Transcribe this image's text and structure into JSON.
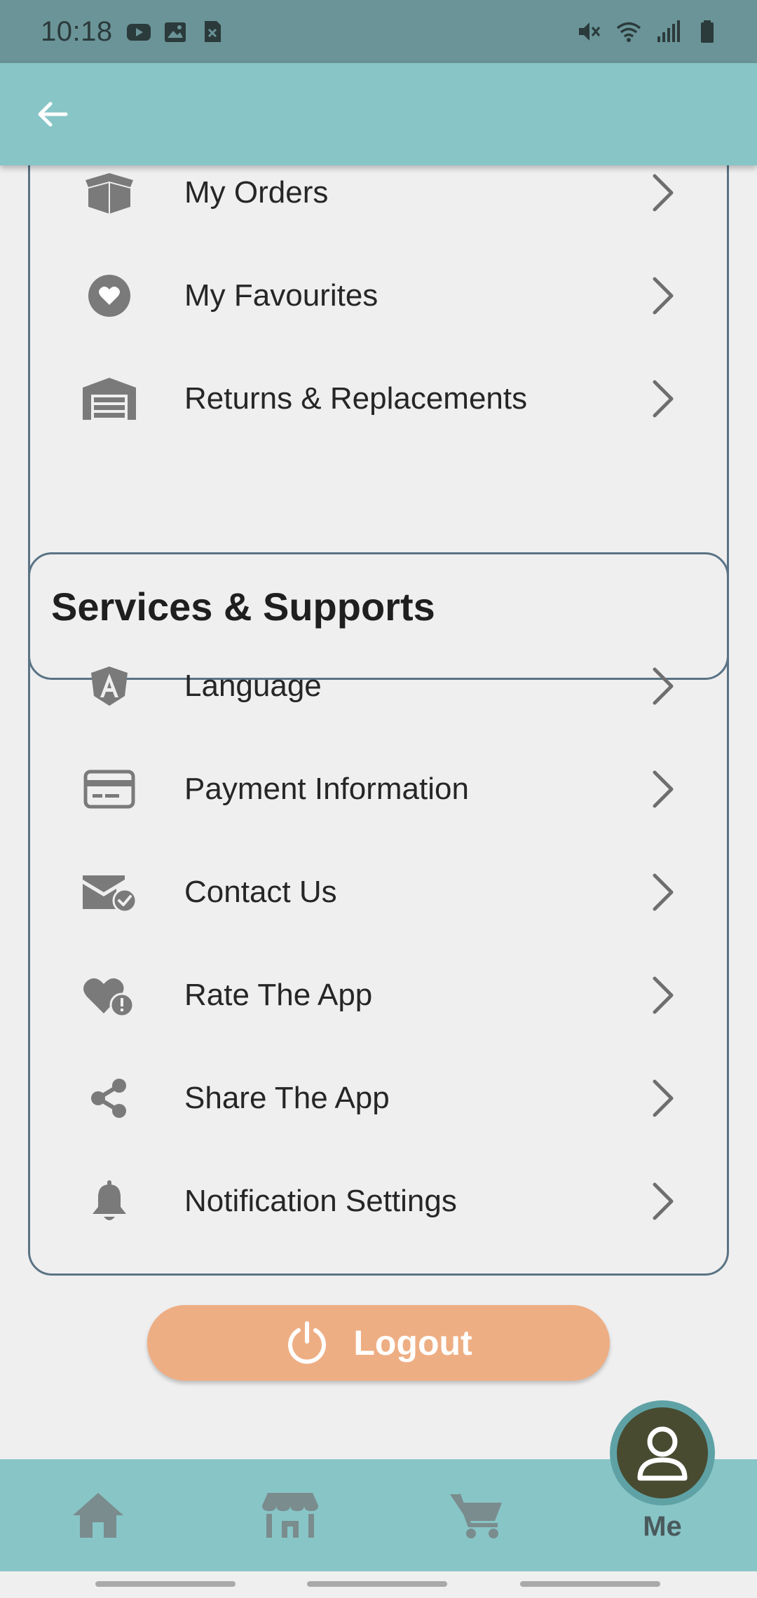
{
  "status_bar": {
    "time": "10:18",
    "left_icons": [
      "youtube-icon",
      "image-icon",
      "close-box-icon"
    ],
    "right_icons": [
      "mute-icon",
      "wifi-icon",
      "signal-icon",
      "battery-icon"
    ]
  },
  "app_bar": {
    "back_icon": "arrow-left-icon"
  },
  "orders_card": {
    "items": [
      {
        "label": "My Orders",
        "icon": "box-open-icon"
      },
      {
        "label": "My Favourites",
        "icon": "heart-circle-icon"
      },
      {
        "label": "Returns & Replacements",
        "icon": "warehouse-icon"
      }
    ]
  },
  "services_card": {
    "title": "Services & Supports",
    "items": [
      {
        "label": "Language",
        "icon": "angular-shield-icon"
      },
      {
        "label": "Payment Information",
        "icon": "credit-card-icon"
      },
      {
        "label": "Contact Us",
        "icon": "mail-check-icon"
      },
      {
        "label": "Rate The App",
        "icon": "heart-alert-icon"
      },
      {
        "label": "Share The App",
        "icon": "share-icon"
      },
      {
        "label": "Notification Settings",
        "icon": "bell-icon"
      }
    ]
  },
  "logout": {
    "label": "Logout",
    "icon": "power-icon",
    "color": "#eeae83"
  },
  "bottom_nav": {
    "items": [
      {
        "name": "home",
        "icon": "home-icon"
      },
      {
        "name": "store",
        "icon": "store-icon"
      },
      {
        "name": "cart",
        "icon": "cart-icon"
      }
    ],
    "active": {
      "label": "Me",
      "icon": "person-icon"
    }
  },
  "colors": {
    "app_bar": "#88c5c7",
    "status_bar": "#6a9497",
    "card_border": "#5a7384",
    "background": "#efeff0",
    "icon_gray": "#7a7a7a",
    "me_circle": "#484b30"
  }
}
